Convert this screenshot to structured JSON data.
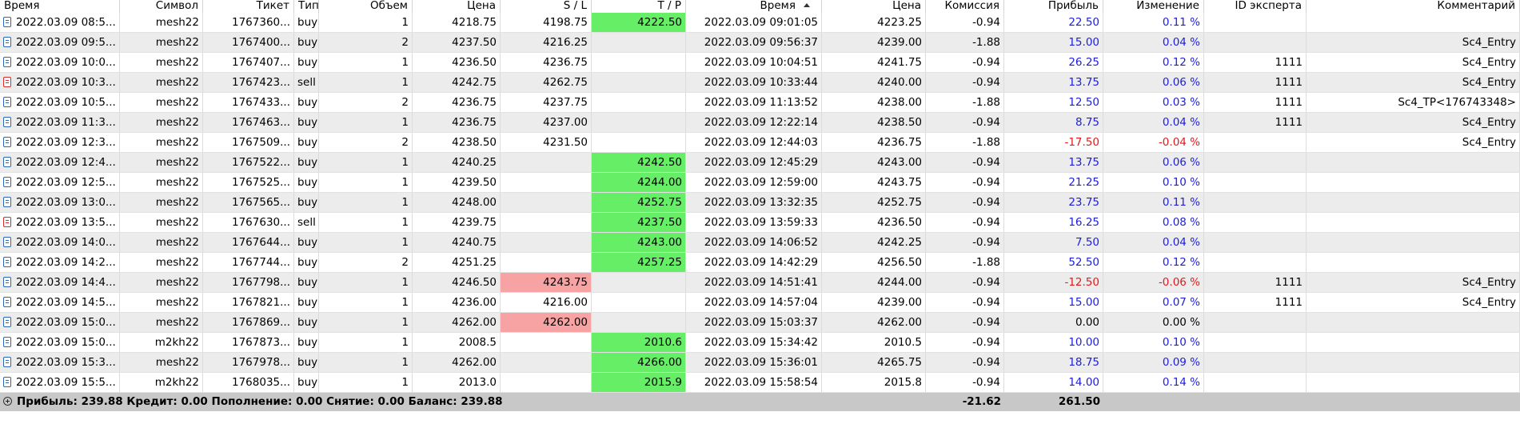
{
  "headers": [
    "Время",
    "Символ",
    "Тикет",
    "Тип",
    "Объем",
    "Цена",
    "S / L",
    "T / P",
    "Время",
    "Цена",
    "Комиссия",
    "Прибыль",
    "Изменение",
    "ID эксперта",
    "Комментарий"
  ],
  "rows": [
    {
      "t1": "2022.03.09 08:5...",
      "sym": "mesh22",
      "ticket": "1767360...",
      "type": "buy",
      "vol": "1",
      "price": "4218.75",
      "sl": "4198.75",
      "tp": "4222.50",
      "t2": "2022.03.09 09:01:05",
      "cprice": "4223.25",
      "comm": "-0.94",
      "profit": "22.50",
      "change": "0.11 %",
      "expert": "",
      "comment": "",
      "tp_hl": true,
      "sl_hl": false,
      "neg": false
    },
    {
      "t1": "2022.03.09 09:5...",
      "sym": "mesh22",
      "ticket": "1767400...",
      "type": "buy",
      "vol": "2",
      "price": "4237.50",
      "sl": "4216.25",
      "tp": "",
      "t2": "2022.03.09 09:56:37",
      "cprice": "4239.00",
      "comm": "-1.88",
      "profit": "15.00",
      "change": "0.04 %",
      "expert": "",
      "comment": "Sc4_Entry",
      "tp_hl": false,
      "sl_hl": false,
      "neg": false
    },
    {
      "t1": "2022.03.09 10:0...",
      "sym": "mesh22",
      "ticket": "1767407...",
      "type": "buy",
      "vol": "1",
      "price": "4236.50",
      "sl": "4236.75",
      "tp": "",
      "t2": "2022.03.09 10:04:51",
      "cprice": "4241.75",
      "comm": "-0.94",
      "profit": "26.25",
      "change": "0.12 %",
      "expert": "1111",
      "comment": "Sc4_Entry",
      "tp_hl": false,
      "sl_hl": false,
      "neg": false
    },
    {
      "t1": "2022.03.09 10:3...",
      "sym": "mesh22",
      "ticket": "1767423...",
      "type": "sell",
      "vol": "1",
      "price": "4242.75",
      "sl": "4262.75",
      "tp": "",
      "t2": "2022.03.09 10:33:44",
      "cprice": "4240.00",
      "comm": "-0.94",
      "profit": "13.75",
      "change": "0.06 %",
      "expert": "1111",
      "comment": "Sc4_Entry",
      "tp_hl": false,
      "sl_hl": false,
      "neg": false
    },
    {
      "t1": "2022.03.09 10:5...",
      "sym": "mesh22",
      "ticket": "1767433...",
      "type": "buy",
      "vol": "2",
      "price": "4236.75",
      "sl": "4237.75",
      "tp": "",
      "t2": "2022.03.09 11:13:52",
      "cprice": "4238.00",
      "comm": "-1.88",
      "profit": "12.50",
      "change": "0.03 %",
      "expert": "1111",
      "comment": "Sc4_TP<176743348>",
      "tp_hl": false,
      "sl_hl": false,
      "neg": false
    },
    {
      "t1": "2022.03.09 11:3...",
      "sym": "mesh22",
      "ticket": "1767463...",
      "type": "buy",
      "vol": "1",
      "price": "4236.75",
      "sl": "4237.00",
      "tp": "",
      "t2": "2022.03.09 12:22:14",
      "cprice": "4238.50",
      "comm": "-0.94",
      "profit": "8.75",
      "change": "0.04 %",
      "expert": "1111",
      "comment": "Sc4_Entry",
      "tp_hl": false,
      "sl_hl": false,
      "neg": false
    },
    {
      "t1": "2022.03.09 12:3...",
      "sym": "mesh22",
      "ticket": "1767509...",
      "type": "buy",
      "vol": "2",
      "price": "4238.50",
      "sl": "4231.50",
      "tp": "",
      "t2": "2022.03.09 12:44:03",
      "cprice": "4236.75",
      "comm": "-1.88",
      "profit": "-17.50",
      "change": "-0.04 %",
      "expert": "",
      "comment": "Sc4_Entry",
      "tp_hl": false,
      "sl_hl": false,
      "neg": true
    },
    {
      "t1": "2022.03.09 12:4...",
      "sym": "mesh22",
      "ticket": "1767522...",
      "type": "buy",
      "vol": "1",
      "price": "4240.25",
      "sl": "",
      "tp": "4242.50",
      "t2": "2022.03.09 12:45:29",
      "cprice": "4243.00",
      "comm": "-0.94",
      "profit": "13.75",
      "change": "0.06 %",
      "expert": "",
      "comment": "",
      "tp_hl": true,
      "sl_hl": false,
      "neg": false
    },
    {
      "t1": "2022.03.09 12:5...",
      "sym": "mesh22",
      "ticket": "1767525...",
      "type": "buy",
      "vol": "1",
      "price": "4239.50",
      "sl": "",
      "tp": "4244.00",
      "t2": "2022.03.09 12:59:00",
      "cprice": "4243.75",
      "comm": "-0.94",
      "profit": "21.25",
      "change": "0.10 %",
      "expert": "",
      "comment": "",
      "tp_hl": true,
      "sl_hl": false,
      "neg": false
    },
    {
      "t1": "2022.03.09 13:0...",
      "sym": "mesh22",
      "ticket": "1767565...",
      "type": "buy",
      "vol": "1",
      "price": "4248.00",
      "sl": "",
      "tp": "4252.75",
      "t2": "2022.03.09 13:32:35",
      "cprice": "4252.75",
      "comm": "-0.94",
      "profit": "23.75",
      "change": "0.11 %",
      "expert": "",
      "comment": "",
      "tp_hl": true,
      "sl_hl": false,
      "neg": false
    },
    {
      "t1": "2022.03.09 13:5...",
      "sym": "mesh22",
      "ticket": "1767630...",
      "type": "sell",
      "vol": "1",
      "price": "4239.75",
      "sl": "",
      "tp": "4237.50",
      "t2": "2022.03.09 13:59:33",
      "cprice": "4236.50",
      "comm": "-0.94",
      "profit": "16.25",
      "change": "0.08 %",
      "expert": "",
      "comment": "",
      "tp_hl": true,
      "sl_hl": false,
      "neg": false
    },
    {
      "t1": "2022.03.09 14:0...",
      "sym": "mesh22",
      "ticket": "1767644...",
      "type": "buy",
      "vol": "1",
      "price": "4240.75",
      "sl": "",
      "tp": "4243.00",
      "t2": "2022.03.09 14:06:52",
      "cprice": "4242.25",
      "comm": "-0.94",
      "profit": "7.50",
      "change": "0.04 %",
      "expert": "",
      "comment": "",
      "tp_hl": true,
      "sl_hl": false,
      "neg": false
    },
    {
      "t1": "2022.03.09 14:2...",
      "sym": "mesh22",
      "ticket": "1767744...",
      "type": "buy",
      "vol": "2",
      "price": "4251.25",
      "sl": "",
      "tp": "4257.25",
      "t2": "2022.03.09 14:42:29",
      "cprice": "4256.50",
      "comm": "-1.88",
      "profit": "52.50",
      "change": "0.12 %",
      "expert": "",
      "comment": "",
      "tp_hl": true,
      "sl_hl": false,
      "neg": false
    },
    {
      "t1": "2022.03.09 14:4...",
      "sym": "mesh22",
      "ticket": "1767798...",
      "type": "buy",
      "vol": "1",
      "price": "4246.50",
      "sl": "4243.75",
      "tp": "",
      "t2": "2022.03.09 14:51:41",
      "cprice": "4244.00",
      "comm": "-0.94",
      "profit": "-12.50",
      "change": "-0.06 %",
      "expert": "1111",
      "comment": "Sc4_Entry",
      "tp_hl": false,
      "sl_hl": true,
      "neg": true
    },
    {
      "t1": "2022.03.09 14:5...",
      "sym": "mesh22",
      "ticket": "1767821...",
      "type": "buy",
      "vol": "1",
      "price": "4236.00",
      "sl": "4216.00",
      "tp": "",
      "t2": "2022.03.09 14:57:04",
      "cprice": "4239.00",
      "comm": "-0.94",
      "profit": "15.00",
      "change": "0.07 %",
      "expert": "1111",
      "comment": "Sc4_Entry",
      "tp_hl": false,
      "sl_hl": false,
      "neg": false
    },
    {
      "t1": "2022.03.09 15:0...",
      "sym": "mesh22",
      "ticket": "1767869...",
      "type": "buy",
      "vol": "1",
      "price": "4262.00",
      "sl": "4262.00",
      "tp": "",
      "t2": "2022.03.09 15:03:37",
      "cprice": "4262.00",
      "comm": "-0.94",
      "profit": "0.00",
      "change": "0.00 %",
      "expert": "",
      "comment": "",
      "tp_hl": false,
      "sl_hl": true,
      "neg": false,
      "zero": true
    },
    {
      "t1": "2022.03.09 15:0...",
      "sym": "m2kh22",
      "ticket": "1767873...",
      "type": "buy",
      "vol": "1",
      "price": "2008.5",
      "sl": "",
      "tp": "2010.6",
      "t2": "2022.03.09 15:34:42",
      "cprice": "2010.5",
      "comm": "-0.94",
      "profit": "10.00",
      "change": "0.10 %",
      "expert": "",
      "comment": "",
      "tp_hl": true,
      "sl_hl": false,
      "neg": false
    },
    {
      "t1": "2022.03.09 15:3...",
      "sym": "mesh22",
      "ticket": "1767978...",
      "type": "buy",
      "vol": "1",
      "price": "4262.00",
      "sl": "",
      "tp": "4266.00",
      "t2": "2022.03.09 15:36:01",
      "cprice": "4265.75",
      "comm": "-0.94",
      "profit": "18.75",
      "change": "0.09 %",
      "expert": "",
      "comment": "",
      "tp_hl": true,
      "sl_hl": false,
      "neg": false
    },
    {
      "t1": "2022.03.09 15:5...",
      "sym": "m2kh22",
      "ticket": "1768035...",
      "type": "buy",
      "vol": "1",
      "price": "2013.0",
      "sl": "",
      "tp": "2015.9",
      "t2": "2022.03.09 15:58:54",
      "cprice": "2015.8",
      "comm": "-0.94",
      "profit": "14.00",
      "change": "0.14 %",
      "expert": "",
      "comment": "",
      "tp_hl": true,
      "sl_hl": false,
      "neg": false
    }
  ],
  "summary": {
    "text": "Прибыль: 239.88  Кредит: 0.00  Пополнение: 0.00  Снятие: 0.00  Баланс: 239.88",
    "commission": "-21.62",
    "profit": "261.50"
  },
  "colors": {
    "profit_positive": "#1d1ddb",
    "profit_negative": "#e01b1b",
    "tp_highlight": "#66ee66",
    "sl_highlight": "#f8a3a3"
  }
}
